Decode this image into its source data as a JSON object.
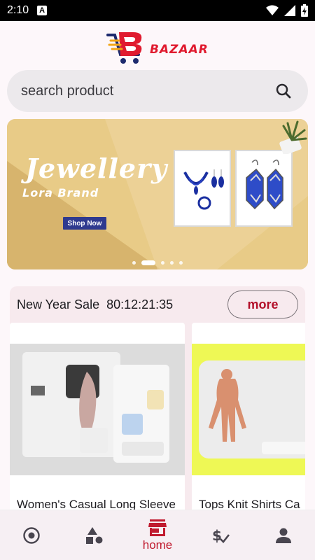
{
  "status_bar": {
    "time": "2:10",
    "notification_icon": "a-icon"
  },
  "brand": {
    "name": "BAZAAR"
  },
  "search": {
    "placeholder": "search product"
  },
  "banner": {
    "title": "Jewellery",
    "subtitle": "Lora Brand",
    "button": "Shop Now",
    "slides": 5,
    "active_slide": 2
  },
  "sale": {
    "title": "New Year Sale",
    "countdown": "80:12:21:35",
    "more": "more",
    "products": [
      {
        "name": "Women's Casual Long Sleeve"
      },
      {
        "name": "Tops Knit Shirts Ca"
      }
    ]
  },
  "nav": {
    "items": [
      {
        "icon": "explore-icon",
        "label": ""
      },
      {
        "icon": "categories-icon",
        "label": ""
      },
      {
        "icon": "store-icon",
        "label": "home",
        "active": true
      },
      {
        "icon": "price-check-icon",
        "label": ""
      },
      {
        "icon": "person-icon",
        "label": ""
      }
    ]
  },
  "colors": {
    "accent": "#c01b2f",
    "banner": "#e2c57f",
    "button": "#2f3a8f"
  }
}
